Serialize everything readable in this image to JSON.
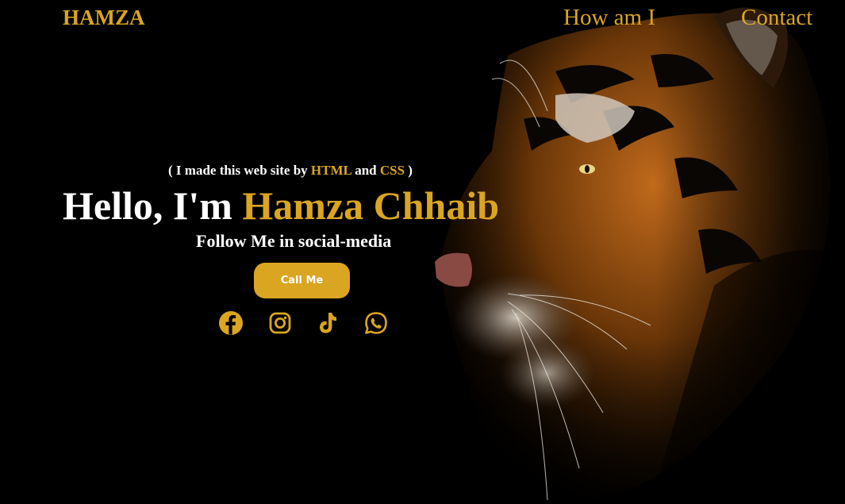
{
  "theme": {
    "accent": "#daa520",
    "background": "#000000",
    "text": "#ffffff"
  },
  "nav": {
    "logo": "HAMZA",
    "links": [
      {
        "label": "How am I"
      },
      {
        "label": "Contact"
      }
    ]
  },
  "hero": {
    "note_open": "( I made this web site by ",
    "note_html": "HTML",
    "note_and": " and ",
    "note_css": "CSS",
    "note_close": " )",
    "title_prefix": "Hello, I'm ",
    "title_name": "Hamza Chhaib",
    "follow_text": "Follow Me in social-media",
    "call_button": "Call Me"
  },
  "social": [
    {
      "icon": "facebook-icon"
    },
    {
      "icon": "instagram-icon"
    },
    {
      "icon": "tiktok-icon"
    },
    {
      "icon": "whatsapp-icon"
    }
  ]
}
